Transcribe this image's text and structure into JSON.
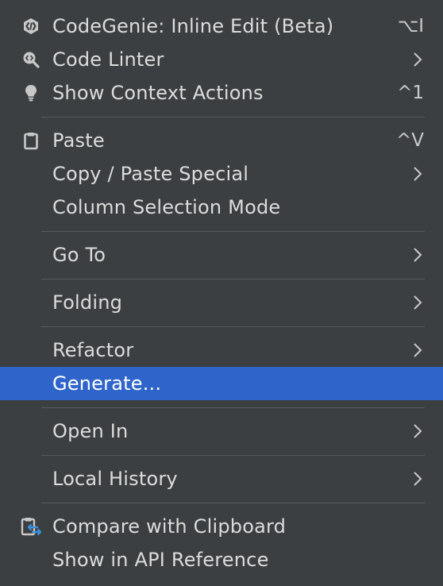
{
  "colors": {
    "background": "#3c3f41",
    "text": "#dcdcdc",
    "selection": "#2f65ca",
    "separator": "#555a5d",
    "accent_icon": "#3b8fd9"
  },
  "menu": {
    "groups": [
      {
        "items": [
          {
            "label": "CodeGenie: Inline Edit (Beta)",
            "shortcut": "⌥I",
            "icon": "codegenie-icon"
          },
          {
            "label": "Code Linter",
            "submenu": true,
            "icon": "code-linter-icon"
          },
          {
            "label": "Show Context Actions",
            "shortcut": "^1",
            "icon": "lightbulb-icon"
          }
        ]
      },
      {
        "items": [
          {
            "label": "Paste",
            "shortcut": "^V",
            "icon": "clipboard-icon"
          },
          {
            "label": "Copy / Paste Special",
            "submenu": true
          },
          {
            "label": "Column Selection Mode"
          }
        ]
      },
      {
        "items": [
          {
            "label": "Go To",
            "submenu": true
          }
        ]
      },
      {
        "items": [
          {
            "label": "Folding",
            "submenu": true
          }
        ]
      },
      {
        "items": [
          {
            "label": "Refactor",
            "submenu": true
          },
          {
            "label": "Generate...",
            "selected": true
          }
        ]
      },
      {
        "items": [
          {
            "label": "Open In",
            "submenu": true
          }
        ]
      },
      {
        "items": [
          {
            "label": "Local History",
            "submenu": true
          }
        ]
      },
      {
        "items": [
          {
            "label": "Compare with Clipboard",
            "icon": "compare-clipboard-icon"
          },
          {
            "label": "Show in API Reference"
          }
        ]
      }
    ]
  }
}
